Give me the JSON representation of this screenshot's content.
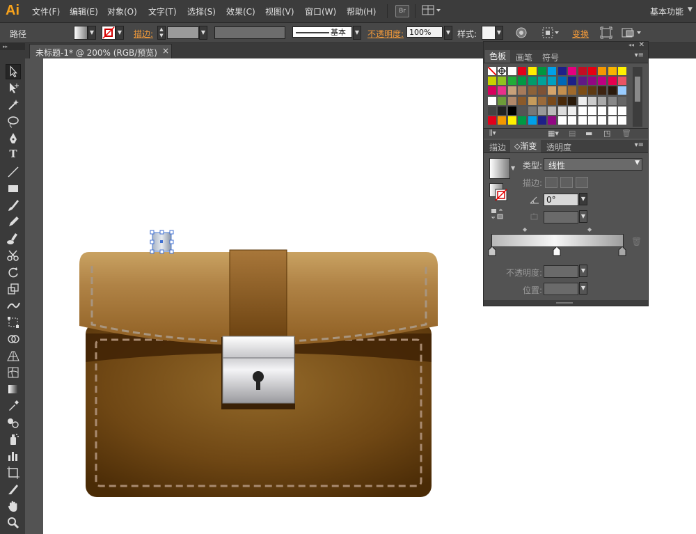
{
  "app": {
    "logo": "Ai"
  },
  "menu": [
    "文件(F)",
    "编辑(E)",
    "对象(O)",
    "文字(T)",
    "选择(S)",
    "效果(C)",
    "视图(V)",
    "窗口(W)",
    "帮助(H)"
  ],
  "bridge_label": "Br",
  "workspace": {
    "label": "基本功能",
    "arrow": "▼"
  },
  "control": {
    "object_type": "路径",
    "stroke_label": "描边:",
    "stroke_style_label": "基本",
    "opacity_label": "不透明度:",
    "opacity_value": "100%",
    "style_label": "样式:",
    "transform_label": "变换"
  },
  "document": {
    "tab_label": "未标题-1* @ 200% (RGB/预览)",
    "close": "×"
  },
  "swatches_panel": {
    "tabs": [
      "色板",
      "画笔",
      "符号"
    ],
    "rows": [
      [
        "#ffffff",
        "#ffffff",
        "#ffffff",
        "#e2001a",
        "#ffed00",
        "#00963f",
        "#00a0e9",
        "#1d2088",
        "#e4007f",
        "#c30d23",
        "#e60012",
        "#f39800",
        "#f8b500",
        "#fff100"
      ],
      [
        "#c9d100",
        "#8fc31f",
        "#22ac38",
        "#009944",
        "#009b6b",
        "#00a29a",
        "#00a0c1",
        "#0068b7",
        "#1d2088",
        "#601986",
        "#920783",
        "#be0081",
        "#e5004f",
        "#e95464"
      ],
      [
        "#d7005b",
        "#e8308a",
        "#c8a17a",
        "#a67b5b",
        "#8c6239",
        "#7d5236",
        "#d4a46a",
        "#c38f4e",
        "#a06a2c",
        "#7d4d14",
        "#5e3a12",
        "#3e2411",
        "#2a1a0c",
        "#99ccff"
      ],
      [
        "#ffffff",
        "#6d9b3a",
        "#b0886a",
        "#8a5a2a",
        "#c59b5b",
        "#9a6a3a",
        "#7a4a1a",
        "#4a2a0a",
        "#2a1a0a",
        "#eeeeee",
        "#cccccc",
        "#aaaaaa",
        "#888888",
        "#666666"
      ],
      [
        "#444444",
        "#222222",
        "#000000",
        "#555555",
        "#777777",
        "#999999",
        "#bbbbbb",
        "#dddddd",
        "#f0f0f0",
        "#ffffff",
        "#ffffff",
        "#ffffff",
        "#ffffff",
        "#ffffff"
      ],
      [
        "#e2001a",
        "#f39800",
        "#fff100",
        "#009944",
        "#00a0e9",
        "#1d2088",
        "#920783",
        "#ffffff",
        "#ffffff",
        "#ffffff",
        "#ffffff",
        "#ffffff",
        "#ffffff",
        "#ffffff"
      ]
    ]
  },
  "gradient_panel": {
    "tabs": [
      "描边",
      "渐变",
      "透明度"
    ],
    "type_label": "类型:",
    "type_value": "线性",
    "stroke_label": "描边:",
    "angle_value": "0°",
    "opacity_label": "不透明度:",
    "location_label": "位置:"
  },
  "colors": {
    "accent": "#f7a21b",
    "orange_label": "#f29a3a",
    "leather_light": "#c89a55",
    "leather_dark": "#5a3408"
  }
}
